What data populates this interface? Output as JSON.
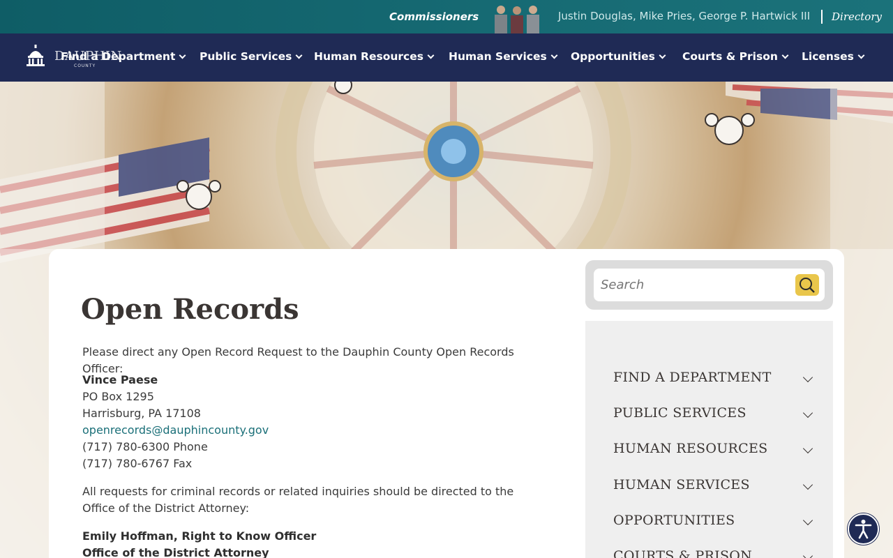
{
  "topbar": {
    "commissioners_label": "Commissioners",
    "commissioner_names": "Justin Douglas, Mike Pries, George P. Hartwick III",
    "directory_label": "Directory"
  },
  "logo": {
    "text": "DAUPHIN",
    "subtext": "COUNTY"
  },
  "nav": {
    "items": [
      "Find a Department",
      "Public Services",
      "Human Resources",
      "Human Services",
      "Opportunities",
      "Courts & Prison",
      "Licenses"
    ]
  },
  "page": {
    "title": "Open Records",
    "intro": "Please direct any Open Record Request to the Dauphin County Open Records Officer:",
    "officer_name": "Vince Paese",
    "po_box": "PO Box 1295",
    "city": "Harrisburg, PA 17108",
    "email": "openrecords@dauphincounty.gov",
    "phone": "(717) 780-6300 Phone",
    "fax": "(717) 780-6767 Fax",
    "criminal_note": "All requests for criminal records or related inquiries should be directed to the Office of the District Attorney:",
    "da_contact": "Emily Hoffman, Right to Know Officer",
    "da_office": "Office of the District Attorney"
  },
  "search": {
    "placeholder": "Search"
  },
  "sidebar": {
    "items": [
      "FIND A DEPARTMENT",
      "PUBLIC SERVICES",
      "HUMAN RESOURCES",
      "HUMAN SERVICES",
      "OPPORTUNITIES",
      "COURTS & PRISON"
    ]
  },
  "colors": {
    "topbar": "#166a73",
    "nav": "#1f2a55",
    "link": "#1a6f78",
    "search_button": "#e9c64b"
  }
}
